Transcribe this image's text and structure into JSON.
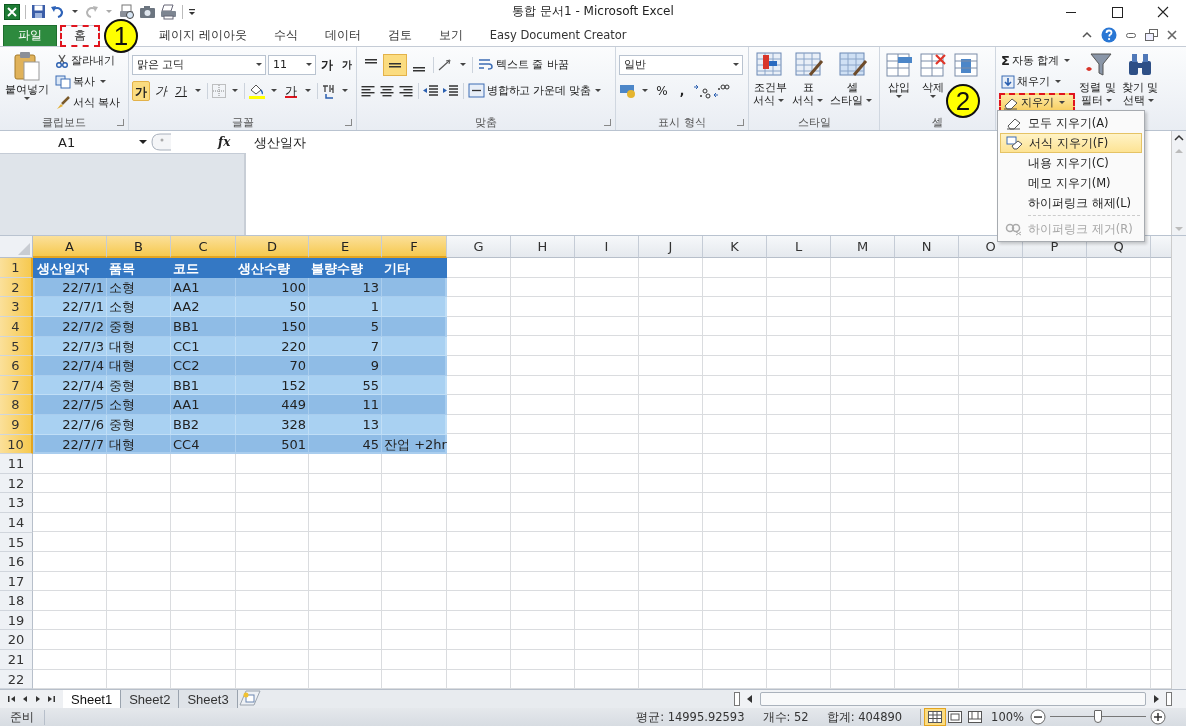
{
  "window": {
    "title": "통합 문서1 - Microsoft Excel"
  },
  "tabs": [
    {
      "label": "파일",
      "kind": "file",
      "selected": false,
      "marked": false
    },
    {
      "label": "홈",
      "kind": "tab",
      "selected": true,
      "marked": true
    },
    {
      "label": "페이지 레이아웃",
      "kind": "tab",
      "selected": false,
      "marked": false
    },
    {
      "label": "수식",
      "kind": "tab",
      "selected": false,
      "marked": false
    },
    {
      "label": "데이터",
      "kind": "tab",
      "selected": false,
      "marked": false
    },
    {
      "label": "검토",
      "kind": "tab",
      "selected": false,
      "marked": false
    },
    {
      "label": "보기",
      "kind": "tab",
      "selected": false,
      "marked": false
    },
    {
      "label": "Easy Document Creator",
      "kind": "tab",
      "selected": false,
      "marked": false
    }
  ],
  "callouts": [
    "1",
    "2"
  ],
  "clipboard": {
    "label": "클립보드",
    "paste": "붙여넣기",
    "cut": "잘라내기",
    "copy": "복사",
    "format_painter": "서식 복사"
  },
  "font": {
    "label": "글꼴",
    "font_name": "맑은 고딕",
    "font_size": "11",
    "grow": "가",
    "shrink": "가",
    "bold": {
      "label": "가",
      "selected": true
    },
    "italic": "가",
    "underline": "가",
    "font_color": "가"
  },
  "alignment": {
    "label": "맞춤",
    "vertical": [
      {
        "selected": false
      },
      {
        "selected": true
      },
      {
        "selected": false
      }
    ],
    "wrap": "텍스트 줄 바꿈",
    "merge": "병합하고 가운데 맞춤"
  },
  "number": {
    "label": "표시 형식",
    "format": "일반",
    "percent": "%",
    "comma": ","
  },
  "styles": {
    "label": "스타일",
    "buttons": [
      [
        "조건부",
        "서식"
      ],
      [
        "표",
        "서식"
      ],
      [
        "셀",
        "스타일"
      ]
    ]
  },
  "cells": {
    "label": "셀",
    "buttons": [
      "삽입",
      "삭제"
    ]
  },
  "editing": {
    "autosum_symbol": "Σ",
    "autosum": "자동 합계",
    "fill": "채우기",
    "clear": {
      "label": "지우기",
      "marked": true
    },
    "sort": [
      "정렬 및",
      "필터"
    ],
    "find": [
      "찾기 및",
      "선택"
    ]
  },
  "menu": {
    "items": [
      {
        "label": "모두 지우기(A)",
        "selected": false,
        "disabled": false
      },
      {
        "label": "서식 지우기(F)",
        "selected": true,
        "disabled": false
      },
      {
        "label": "내용 지우기(C)",
        "selected": false,
        "disabled": false
      },
      {
        "label": "메모 지우기(M)",
        "selected": false,
        "disabled": false
      },
      {
        "label": "하이퍼링크 해제(L)",
        "selected": false,
        "disabled": false
      },
      {
        "label": "하이퍼링크 제거(R)",
        "selected": false,
        "disabled": true
      }
    ]
  },
  "formula_bar": {
    "name_box": "A1",
    "fx": "fx",
    "value": "생산일자"
  },
  "table": {
    "columns": [
      {
        "label": "A",
        "kind": "date",
        "selected": true
      },
      {
        "label": "B",
        "kind": "text",
        "selected": true
      },
      {
        "label": "C",
        "kind": "text",
        "selected": true
      },
      {
        "label": "D",
        "kind": "number",
        "selected": true
      },
      {
        "label": "E",
        "kind": "number",
        "selected": true
      },
      {
        "label": "F",
        "kind": "text",
        "selected": true
      },
      {
        "label": "G",
        "selected": false
      },
      {
        "label": "H",
        "selected": false
      },
      {
        "label": "I",
        "selected": false
      },
      {
        "label": "J",
        "selected": false
      },
      {
        "label": "K",
        "selected": false
      },
      {
        "label": "L",
        "selected": false
      },
      {
        "label": "M",
        "selected": false
      },
      {
        "label": "N",
        "selected": false
      },
      {
        "label": "O",
        "selected": false
      },
      {
        "label": "P",
        "selected": false
      },
      {
        "label": "Q",
        "selected": false
      }
    ],
    "rows": [
      {
        "label": "1",
        "selected": true,
        "kind": "header",
        "cells": [
          "생산일자",
          "품목",
          "코드",
          "생산수량",
          "불량수량",
          "기타"
        ]
      },
      {
        "label": "2",
        "selected": true,
        "kind": "band_dark",
        "cells": [
          "22/7/1",
          "소형",
          "AA1",
          "100",
          "13"
        ]
      },
      {
        "label": "3",
        "selected": true,
        "kind": "band_light",
        "cells": [
          "22/7/1",
          "소형",
          "AA2",
          "50",
          "1"
        ]
      },
      {
        "label": "4",
        "selected": true,
        "kind": "band_dark",
        "cells": [
          "22/7/2",
          "중형",
          "BB1",
          "150",
          "5"
        ]
      },
      {
        "label": "5",
        "selected": true,
        "kind": "band_light",
        "cells": [
          "22/7/3",
          "대형",
          "CC1",
          "220",
          "7"
        ]
      },
      {
        "label": "6",
        "selected": true,
        "kind": "band_dark",
        "cells": [
          "22/7/4",
          "대형",
          "CC2",
          "70",
          "9"
        ]
      },
      {
        "label": "7",
        "selected": true,
        "kind": "band_light",
        "cells": [
          "22/7/4",
          "중형",
          "BB1",
          "152",
          "55"
        ]
      },
      {
        "label": "8",
        "selected": true,
        "kind": "band_dark",
        "cells": [
          "22/7/5",
          "소형",
          "AA1",
          "449",
          "11"
        ]
      },
      {
        "label": "9",
        "selected": true,
        "kind": "band_light",
        "cells": [
          "22/7/6",
          "중형",
          "BB2",
          "328",
          "13"
        ]
      },
      {
        "label": "10",
        "selected": true,
        "kind": "band_dark",
        "cells": [
          "22/7/7",
          "대형",
          "CC4",
          "501",
          "45",
          "잔업 +2hr"
        ]
      },
      {
        "label": "11",
        "selected": false,
        "kind": "plain"
      },
      {
        "label": "12",
        "selected": false,
        "kind": "plain"
      },
      {
        "label": "13",
        "selected": false,
        "kind": "plain"
      },
      {
        "label": "14",
        "selected": false,
        "kind": "plain"
      },
      {
        "label": "15",
        "selected": false,
        "kind": "plain"
      },
      {
        "label": "16",
        "selected": false,
        "kind": "plain"
      },
      {
        "label": "17",
        "selected": false,
        "kind": "plain"
      },
      {
        "label": "18",
        "selected": false,
        "kind": "plain"
      },
      {
        "label": "19",
        "selected": false,
        "kind": "plain"
      },
      {
        "label": "20",
        "selected": false,
        "kind": "plain"
      },
      {
        "label": "21",
        "selected": false,
        "kind": "plain"
      },
      {
        "label": "22",
        "selected": false,
        "kind": "plain"
      }
    ]
  },
  "sheets": [
    {
      "label": "Sheet1",
      "selected": true
    },
    {
      "label": "Sheet2",
      "selected": false
    },
    {
      "label": "Sheet3",
      "selected": false
    }
  ],
  "status_bar": {
    "mode": "준비",
    "average": "평균: 14995.92593",
    "count": "개수: 52",
    "sum": "합계: 404890",
    "views": [
      {
        "selected": true
      },
      {
        "selected": false
      },
      {
        "selected": false
      }
    ],
    "zoom": "100%",
    "level": 0.5
  }
}
